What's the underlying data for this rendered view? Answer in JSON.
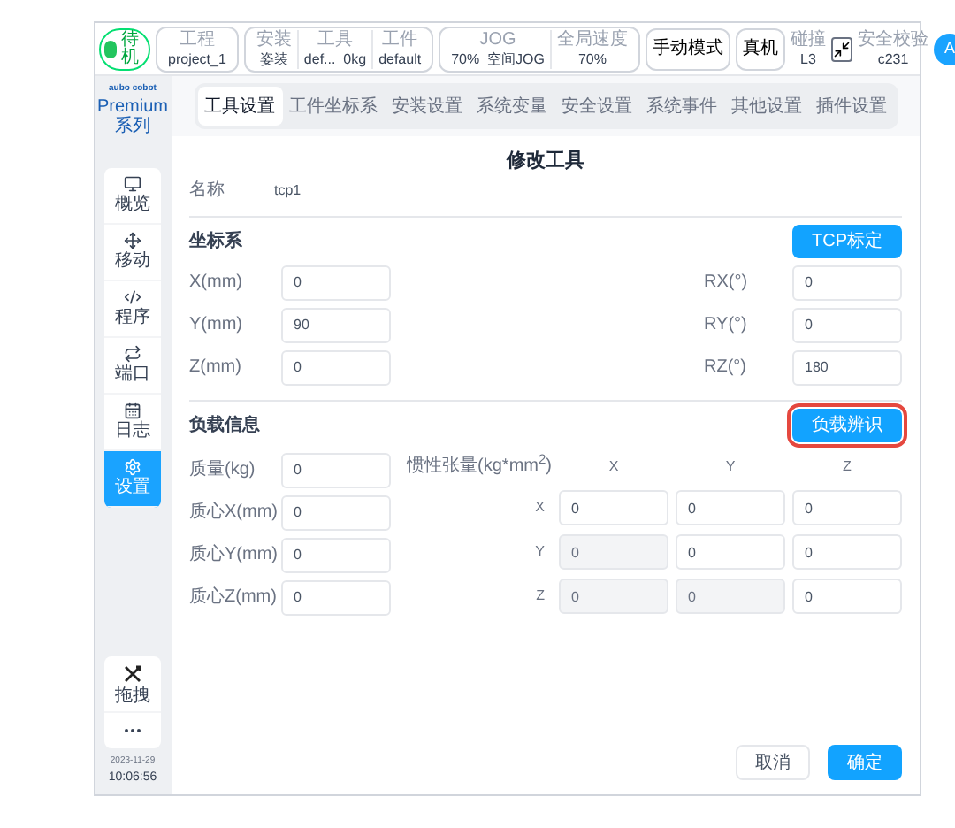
{
  "top_bar": {
    "status": {
      "label": "待机",
      "color": "#22c55e"
    },
    "groups": [
      {
        "items": [
          {
            "label": "工程",
            "value": "project_1"
          }
        ]
      },
      {
        "items": [
          {
            "label": "安装",
            "value": "姿装"
          },
          {
            "label": "工具",
            "value": "def...  0kg"
          },
          {
            "label": "工件",
            "value": "default"
          }
        ]
      },
      {
        "items": [
          {
            "label": "JOG",
            "value": "70%  空间JOG"
          },
          {
            "label": "全局速度",
            "value": "70%"
          }
        ]
      }
    ],
    "mode_button": "手动模式",
    "robot_button": "真机",
    "collision": {
      "label": "碰撞",
      "value": "L3"
    },
    "safety": {
      "label": "安全校验",
      "value": "c231"
    },
    "avatar": "A"
  },
  "sidebar": {
    "brand": "aubo cobot",
    "series": "Premium 系列",
    "items": [
      {
        "label": "概览",
        "selected": false
      },
      {
        "label": "移动",
        "selected": false
      },
      {
        "label": "程序",
        "selected": false
      },
      {
        "label": "端口",
        "selected": false
      },
      {
        "label": "日志",
        "selected": false
      },
      {
        "label": "设置",
        "selected": true
      }
    ],
    "tool": "拖拽",
    "date": "2023-11-29",
    "time": "10:06:56"
  },
  "tabs": [
    {
      "label": "工具设置",
      "selected": true
    },
    {
      "label": "工件坐标系",
      "selected": false
    },
    {
      "label": "安装设置",
      "selected": false
    },
    {
      "label": "系统变量",
      "selected": false
    },
    {
      "label": "安全设置",
      "selected": false
    },
    {
      "label": "系统事件",
      "selected": false
    },
    {
      "label": "其他设置",
      "selected": false
    },
    {
      "label": "插件设置",
      "selected": false
    }
  ],
  "form": {
    "title": "修改工具",
    "name": {
      "label": "名称",
      "value": "tcp1"
    },
    "coordinate": {
      "title": "坐标系",
      "button": "TCP标定",
      "left": [
        {
          "label": "X(mm)",
          "value": "0"
        },
        {
          "label": "Y(mm)",
          "value": "90"
        },
        {
          "label": "Z(mm)",
          "value": "0"
        }
      ],
      "right": [
        {
          "label": "RX(°)",
          "value": "0"
        },
        {
          "label": "RY(°)",
          "value": "0"
        },
        {
          "label": "RZ(°)",
          "value": "180"
        }
      ]
    },
    "load": {
      "title": "负载信息",
      "button": {
        "label": "负载辨识",
        "highlighted": true
      },
      "fields": [
        {
          "label": "质量(kg)",
          "value": "0"
        },
        {
          "label": "质心X(mm)",
          "value": "0"
        },
        {
          "label": "质心Y(mm)",
          "value": "0"
        },
        {
          "label": "质心Z(mm)",
          "value": "0"
        }
      ],
      "inertia": {
        "label": "惯性张量(kg*mm$^{2}$)",
        "columns": [
          "X",
          "Y",
          "Z"
        ],
        "rows": [
          {
            "label": "X",
            "cells": [
              {
                "value": "0",
                "disabled": false
              },
              {
                "value": "0",
                "disabled": false
              },
              {
                "value": "0",
                "disabled": false
              }
            ]
          },
          {
            "label": "Y",
            "cells": [
              {
                "value": "0",
                "disabled": true
              },
              {
                "value": "0",
                "disabled": false
              },
              {
                "value": "0",
                "disabled": false
              }
            ]
          },
          {
            "label": "Z",
            "cells": [
              {
                "value": "0",
                "disabled": true
              },
              {
                "value": "0",
                "disabled": true
              },
              {
                "value": "0",
                "disabled": false
              }
            ]
          }
        ]
      }
    },
    "footer": [
      {
        "label": "取消",
        "kind": "secondary"
      },
      {
        "label": "确定",
        "kind": "primary"
      }
    ]
  }
}
